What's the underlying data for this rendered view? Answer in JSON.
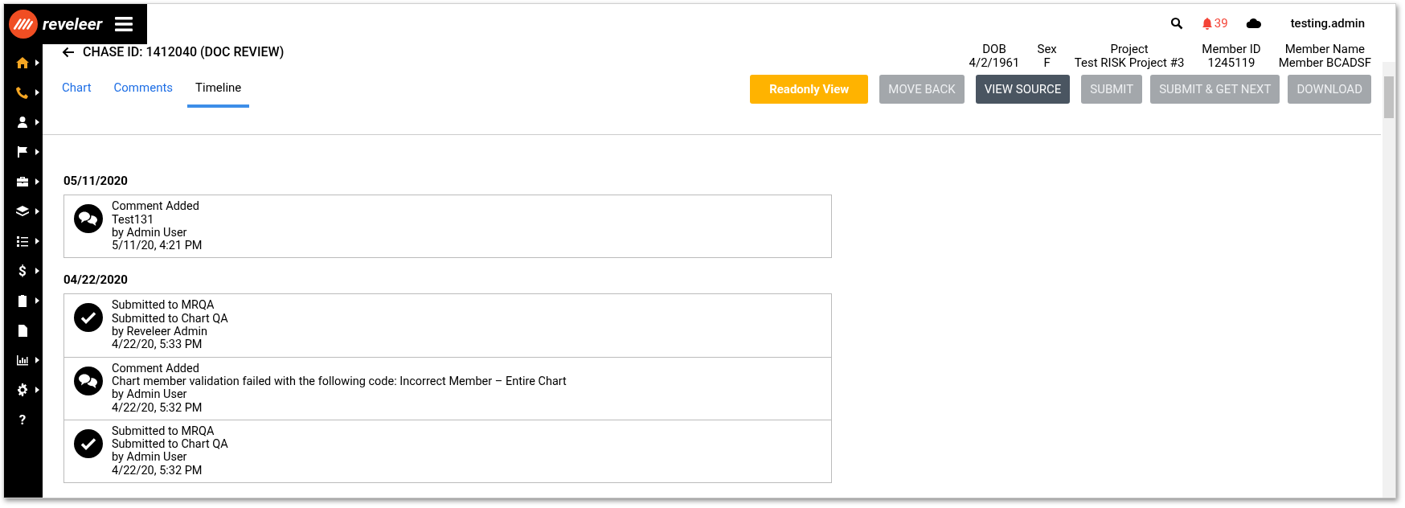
{
  "brand": {
    "name": "reveleer"
  },
  "topbar": {
    "notifications": "39",
    "user": "testing.admin"
  },
  "sidebar": {
    "items": [
      {
        "highlighted": true,
        "has_submenu": true
      },
      {
        "highlighted": true,
        "has_submenu": true
      },
      {
        "highlighted": false,
        "has_submenu": true
      },
      {
        "highlighted": false,
        "has_submenu": true
      },
      {
        "highlighted": false,
        "has_submenu": true
      },
      {
        "highlighted": false,
        "has_submenu": true
      },
      {
        "highlighted": false,
        "has_submenu": true
      },
      {
        "highlighted": false,
        "has_submenu": true,
        "glyph": "$"
      },
      {
        "highlighted": false,
        "has_submenu": true
      },
      {
        "highlighted": false,
        "has_submenu": false
      },
      {
        "highlighted": false,
        "has_submenu": true
      },
      {
        "highlighted": false,
        "has_submenu": true
      },
      {
        "highlighted": false,
        "has_submenu": false,
        "glyph": "?"
      }
    ]
  },
  "page": {
    "title": "CHASE ID: 1412040 (DOC REVIEW)"
  },
  "member_info": [
    {
      "label": "DOB",
      "value": "4/2/1961"
    },
    {
      "label": "Sex",
      "value": "F"
    },
    {
      "label": "Project",
      "value": "Test RISK Project #3"
    },
    {
      "label": "Member ID",
      "value": "1245119"
    },
    {
      "label": "Member Name",
      "value": "Member BCADSF"
    }
  ],
  "tabs": [
    {
      "label": "Chart",
      "selected": false
    },
    {
      "label": "Comments",
      "selected": false
    },
    {
      "label": "Timeline",
      "selected": true
    }
  ],
  "buttons": [
    {
      "label": "Readonly View",
      "kind": "accent",
      "disabled": false
    },
    {
      "label": "MOVE BACK",
      "kind": "action",
      "disabled": true
    },
    {
      "label": "VIEW SOURCE",
      "kind": "action",
      "disabled": false
    },
    {
      "label": "SUBMIT",
      "kind": "action",
      "disabled": true
    },
    {
      "label": "SUBMIT & GET NEXT",
      "kind": "action",
      "disabled": true
    },
    {
      "label": "DOWNLOAD",
      "kind": "action",
      "disabled": true
    }
  ],
  "timeline": [
    {
      "date": "05/11/2020",
      "events": [
        {
          "kind": "comment",
          "lines": [
            "Comment Added",
            "Test131",
            "by Admin User",
            "5/11/20, 4:21 PM"
          ]
        }
      ]
    },
    {
      "date": "04/22/2020",
      "events": [
        {
          "kind": "submitted",
          "lines": [
            "Submitted to MRQA",
            "Submitted to Chart QA",
            "by Reveleer Admin",
            "4/22/20, 5:33 PM"
          ]
        },
        {
          "kind": "comment",
          "lines": [
            "Comment Added",
            "Chart member validation failed with the following code: Incorrect Member – Entire Chart",
            "by Admin User",
            "4/22/20, 5:32 PM"
          ]
        },
        {
          "kind": "submitted",
          "lines": [
            "Submitted to MRQA",
            "Submitted to Chart QA",
            "by Admin User",
            "4/22/20, 5:32 PM"
          ]
        }
      ]
    }
  ]
}
